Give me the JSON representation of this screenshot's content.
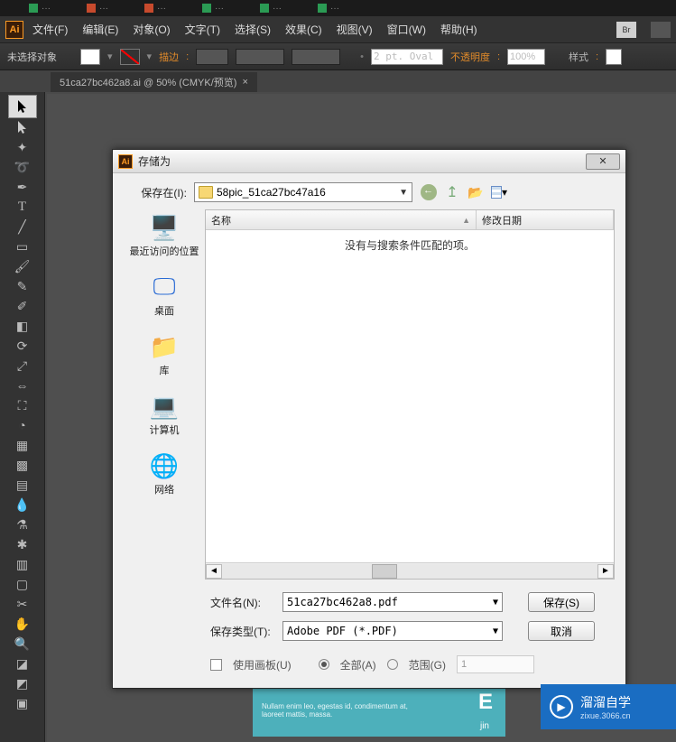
{
  "browser_tabs": [
    "···",
    "···",
    "···",
    "···",
    "···",
    "···"
  ],
  "menubar": {
    "file": "文件(F)",
    "edit": "编辑(E)",
    "object": "对象(O)",
    "type": "文字(T)",
    "select": "选择(S)",
    "effect": "效果(C)",
    "view": "视图(V)",
    "window": "窗口(W)",
    "help": "帮助(H)",
    "br": "Br"
  },
  "optionbar": {
    "noselection": "未选择对象",
    "stroke": "描边",
    "strokeval": "",
    "dash": "",
    "pt": "2 pt. Oval",
    "opacity_label": "不透明度",
    "opacity": "100%",
    "style": "样式"
  },
  "doc_tab": "51ca27bc462a8.ai @ 50% (CMYK/预览)",
  "dialog": {
    "title": "存储为",
    "savein_label": "保存在(I):",
    "folder": "58pic_51ca27bc47a16",
    "col_name": "名称",
    "col_date": "修改日期",
    "empty": "没有与搜索条件匹配的项。",
    "places": {
      "recent": "最近访问的位置",
      "desktop": "桌面",
      "libs": "库",
      "computer": "计算机",
      "network": "网络"
    },
    "filename_label": "文件名(N):",
    "filename": "51ca27bc462a8.pdf",
    "type_label": "保存类型(T):",
    "type": "Adobe PDF (*.PDF)",
    "save_btn": "保存(S)",
    "cancel_btn": "取消",
    "use_artboards": "使用画板(U)",
    "all": "全部(A)",
    "range": "范围(G)",
    "range_val": "1"
  },
  "watermark": {
    "brand": "溜溜自学",
    "url": "zixue.3066.cn"
  },
  "teal": {
    "line1": "Nullam enim leo, egestas id, condimentum at,",
    "line2": "laoreet mattis, massa.",
    "big": "E",
    "sub": "jin"
  }
}
